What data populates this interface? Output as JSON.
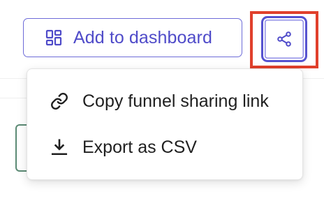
{
  "toolbar": {
    "add_to_dashboard_label": "Add to dashboard",
    "add_to_dashboard_icon": "dashboard-grid-icon",
    "share_icon": "share-icon",
    "accent_color": "#4f4bc9",
    "highlight_color": "#e0402c"
  },
  "share_menu": {
    "items": [
      {
        "label": "Copy funnel sharing link",
        "icon": "link-icon"
      },
      {
        "label": "Export as CSV",
        "icon": "download-icon"
      }
    ]
  }
}
